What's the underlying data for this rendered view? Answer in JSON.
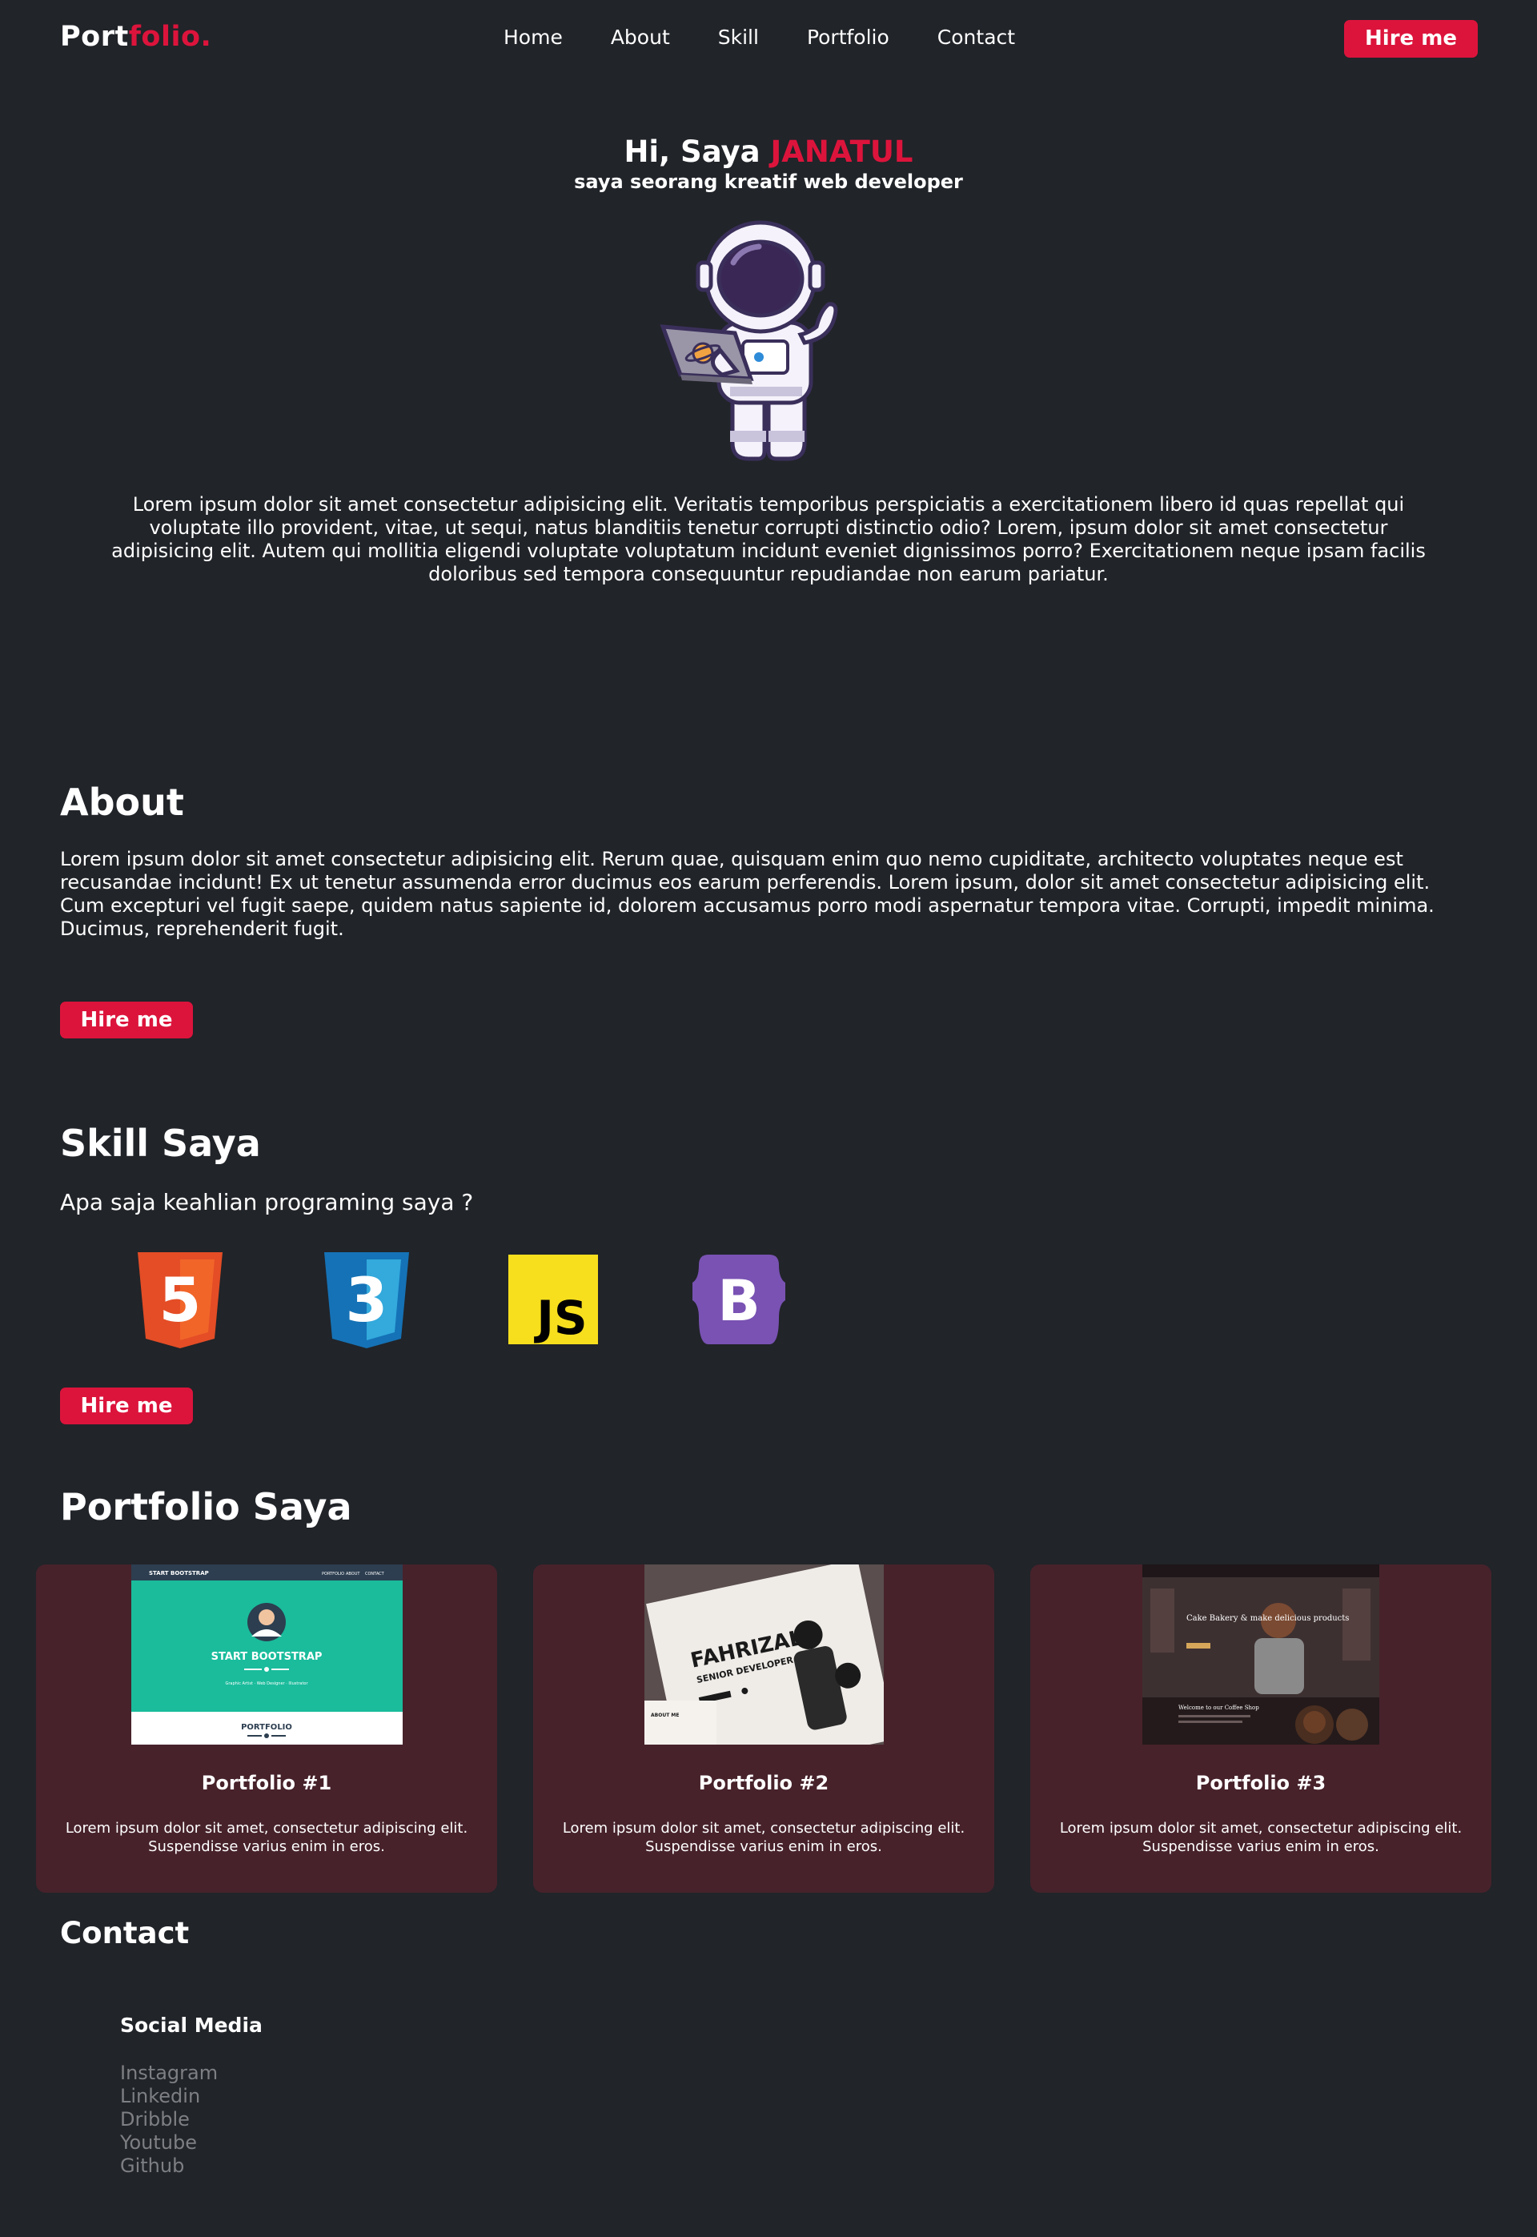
{
  "nav": {
    "brand_part1": "Port",
    "brand_part2": "folio.",
    "links": [
      "Home",
      "About",
      "Skill",
      "Portfolio",
      "Contact"
    ],
    "hire_label": "Hire me"
  },
  "hero": {
    "greeting": "Hi, Saya",
    "name": "JANATUL",
    "subtitle": "saya seorang kreatif web developer",
    "paragraph": "Lorem ipsum dolor sit amet consectetur adipisicing elit. Veritatis temporibus perspiciatis a exercitationem libero id quas repellat qui voluptate illo provident, vitae, ut sequi, natus blanditiis tenetur corrupti distinctio odio? Lorem, ipsum dolor sit amet consectetur adipisicing elit. Autem qui mollitia eligendi voluptate voluptatum incidunt eveniet dignissimos porro? Exercitationem neque ipsam facilis doloribus sed tempora consequuntur repudiandae non earum pariatur."
  },
  "about": {
    "title": "About",
    "paragraph": "Lorem ipsum dolor sit amet consectetur adipisicing elit. Rerum quae, quisquam enim quo nemo cupiditate, architecto voluptates neque est recusandae incidunt! Ex ut tenetur assumenda error ducimus eos earum perferendis. Lorem ipsum, dolor sit amet consectetur adipisicing elit. Cum excepturi vel fugit saepe, quidem natus sapiente id, dolorem accusamus porro modi aspernatur tempora vitae. Corrupti, impedit minima. Ducimus, reprehenderit fugit.",
    "hire_label": "Hire me"
  },
  "skill": {
    "title": "Skill Saya",
    "subtitle": "Apa saja keahlian programing saya ?",
    "icons": [
      "html5-icon",
      "css3-icon",
      "javascript-icon",
      "bootstrap-icon"
    ],
    "html_num": "5",
    "css_num": "3",
    "js_text": "JS",
    "bs_text": "B",
    "hire_label": "Hire me"
  },
  "portfolio": {
    "title": "Portfolio Saya",
    "cards": [
      {
        "title": "Portfolio #1",
        "text": "Lorem ipsum dolor sit amet, consectetur adipiscing elit. Suspendisse varius enim in eros.",
        "thumb": {
          "nav_brand": "START BOOTSTRAP",
          "nav_links": [
            "PORTFOLIO",
            "ABOUT",
            "CONTACT"
          ],
          "headline": "START BOOTSTRAP",
          "tagline": "Graphic Artist · Web Designer · Illustrator",
          "section": "PORTFOLIO"
        }
      },
      {
        "title": "Portfolio #2",
        "text": "Lorem ipsum dolor sit amet, consectetur adipiscing elit. Suspendisse varius enim in eros.",
        "thumb": {
          "name": "FAHRIZAL",
          "role": "SENIOR DEVELOPER",
          "section": "ABOUT ME"
        }
      },
      {
        "title": "Portfolio #3",
        "text": "Lorem ipsum dolor sit amet, consectetur adipiscing elit. Suspendisse varius enim in eros.",
        "thumb": {
          "headline": "Cake Bakery & make delicious products",
          "welcome": "Welcome to our Coffee Shop"
        }
      }
    ]
  },
  "contact": {
    "title": "Contact",
    "social_title": "Social Media",
    "links": [
      "Instagram",
      "Linkedin",
      "Dribble",
      "Youtube",
      "Github"
    ]
  },
  "colors": {
    "background": "#212429",
    "accent": "#dc143c",
    "card": "#47222b",
    "muted_link": "#7d7f83"
  }
}
